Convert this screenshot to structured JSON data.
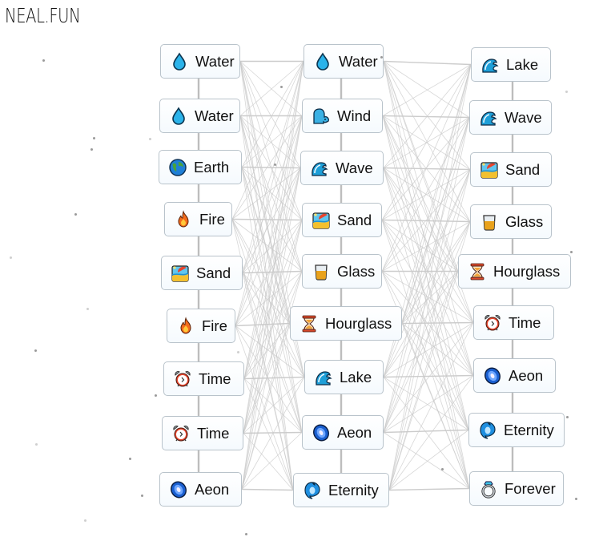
{
  "app": {
    "logo": "NEAL.FUN"
  },
  "colors": {
    "node_border": "#b9c3cb",
    "edge": "#c9c9c9",
    "text": "#111111"
  },
  "columns": [
    {
      "nodes": [
        {
          "label": "Water",
          "icon": "water-drop-icon"
        },
        {
          "label": "Water",
          "icon": "water-drop-icon"
        },
        {
          "label": "Earth",
          "icon": "globe-icon"
        },
        {
          "label": "Fire",
          "icon": "fire-icon"
        },
        {
          "label": "Sand",
          "icon": "beach-umbrella-icon"
        },
        {
          "label": "Fire",
          "icon": "fire-icon"
        },
        {
          "label": "Time",
          "icon": "alarm-clock-icon"
        },
        {
          "label": "Time",
          "icon": "alarm-clock-icon"
        },
        {
          "label": "Aeon",
          "icon": "galaxy-icon"
        }
      ]
    },
    {
      "nodes": [
        {
          "label": "Water",
          "icon": "water-drop-icon"
        },
        {
          "label": "Wind",
          "icon": "wind-face-icon"
        },
        {
          "label": "Wave",
          "icon": "wave-icon"
        },
        {
          "label": "Sand",
          "icon": "beach-umbrella-icon"
        },
        {
          "label": "Glass",
          "icon": "tumbler-glass-icon"
        },
        {
          "label": "Hourglass",
          "icon": "hourglass-icon"
        },
        {
          "label": "Lake",
          "icon": "wave-icon"
        },
        {
          "label": "Aeon",
          "icon": "galaxy-icon"
        },
        {
          "label": "Eternity",
          "icon": "cyclone-icon"
        }
      ]
    },
    {
      "nodes": [
        {
          "label": "Lake",
          "icon": "wave-icon"
        },
        {
          "label": "Wave",
          "icon": "wave-icon"
        },
        {
          "label": "Sand",
          "icon": "beach-umbrella-icon"
        },
        {
          "label": "Glass",
          "icon": "tumbler-glass-icon"
        },
        {
          "label": "Hourglass",
          "icon": "hourglass-icon"
        },
        {
          "label": "Time",
          "icon": "alarm-clock-icon"
        },
        {
          "label": "Aeon",
          "icon": "galaxy-icon"
        },
        {
          "label": "Eternity",
          "icon": "cyclone-icon"
        },
        {
          "label": "Forever",
          "icon": "ring-icon"
        }
      ]
    }
  ]
}
